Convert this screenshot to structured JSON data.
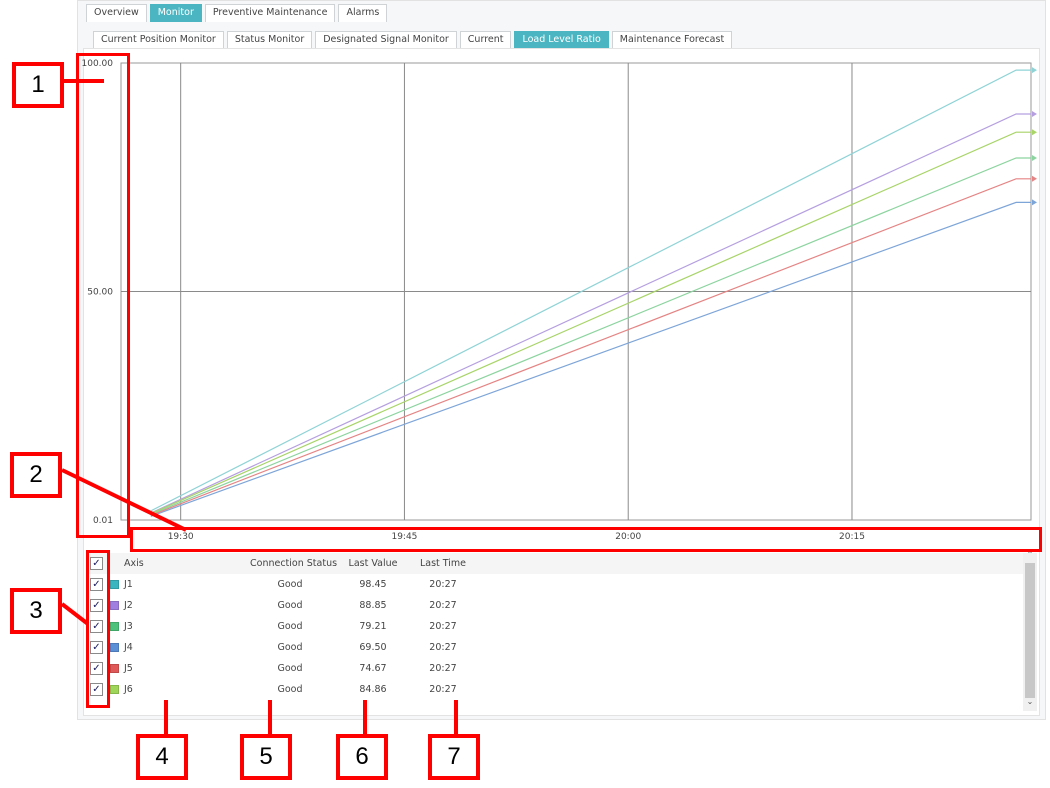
{
  "top_tabs": [
    "Overview",
    "Monitor",
    "Preventive Maintenance",
    "Alarms"
  ],
  "top_tab_active": "Monitor",
  "sub_tabs": [
    "Current Position Monitor",
    "Status Monitor",
    "Designated Signal Monitor",
    "Current",
    "Load Level Ratio",
    "Maintenance Forecast"
  ],
  "sub_tab_active": "Load Level Ratio",
  "chart_data": {
    "type": "line",
    "x_ticks": [
      "19:30",
      "19:45",
      "20:00",
      "20:15"
    ],
    "y_ticks": [
      "100.00",
      "50.00",
      "0.01"
    ],
    "xlim": [
      "19:26",
      "20:27"
    ],
    "ylim": [
      0,
      100
    ],
    "grid": true,
    "series": [
      {
        "name": "J1",
        "color": "#8fd3d6",
        "x": [
          "19:28",
          "20:26",
          "20:27"
        ],
        "y": [
          2,
          98.45,
          98.45
        ]
      },
      {
        "name": "J2",
        "color": "#b59fe0",
        "x": [
          "19:28",
          "20:26",
          "20:27"
        ],
        "y": [
          1.5,
          88.85,
          88.85
        ]
      },
      {
        "name": "J3",
        "color": "#8cd49f",
        "x": [
          "19:28",
          "20:26",
          "20:27"
        ],
        "y": [
          1.2,
          79.21,
          79.21
        ]
      },
      {
        "name": "J4",
        "color": "#7ea5d8",
        "x": [
          "19:28",
          "20:26",
          "20:27"
        ],
        "y": [
          0.8,
          69.5,
          69.5
        ]
      },
      {
        "name": "J5",
        "color": "#e58484",
        "x": [
          "19:28",
          "20:26",
          "20:27"
        ],
        "y": [
          1.0,
          74.67,
          74.67
        ]
      },
      {
        "name": "J6",
        "color": "#a8d468",
        "x": [
          "19:28",
          "20:26",
          "20:27"
        ],
        "y": [
          1.4,
          84.86,
          84.86
        ]
      }
    ]
  },
  "table": {
    "headers": {
      "axis": "Axis",
      "connection": "Connection Status",
      "last_value": "Last Value",
      "last_time": "Last Time"
    },
    "rows": [
      {
        "axis": "J1",
        "connection": "Good",
        "last_value": "98.45",
        "last_time": "20:27",
        "color": "#3bb5c0",
        "checked": true
      },
      {
        "axis": "J2",
        "connection": "Good",
        "last_value": "88.85",
        "last_time": "20:27",
        "color": "#a07fe0",
        "checked": true
      },
      {
        "axis": "J3",
        "connection": "Good",
        "last_value": "79.21",
        "last_time": "20:27",
        "color": "#4cc27a",
        "checked": true
      },
      {
        "axis": "J4",
        "connection": "Good",
        "last_value": "69.50",
        "last_time": "20:27",
        "color": "#5b8fd6",
        "checked": true
      },
      {
        "axis": "J5",
        "connection": "Good",
        "last_value": "74.67",
        "last_time": "20:27",
        "color": "#e05858",
        "checked": true
      },
      {
        "axis": "J6",
        "connection": "Good",
        "last_value": "84.86",
        "last_time": "20:27",
        "color": "#9fd65a",
        "checked": true
      }
    ]
  },
  "callouts": [
    "1",
    "2",
    "3",
    "4",
    "5",
    "6",
    "7"
  ],
  "checkmark": "✓",
  "scroll_up": "⌃",
  "scroll_down": "⌄"
}
